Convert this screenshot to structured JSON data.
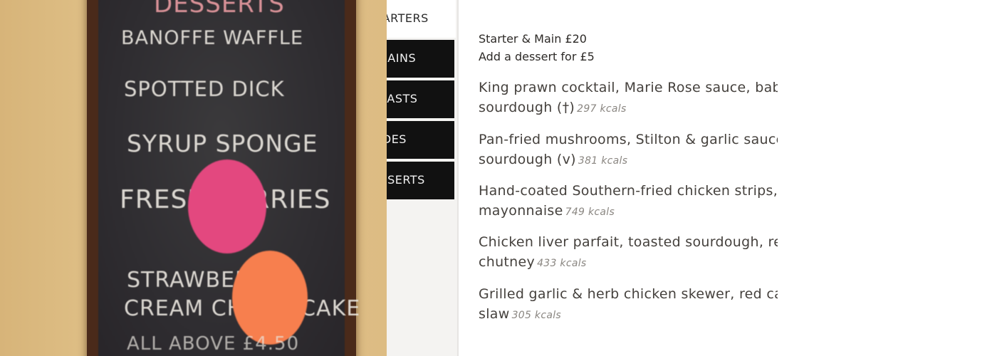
{
  "photo": {
    "board_heading": "Desserts",
    "board_lines": [
      "Banoffe Waffle",
      "Spotted Dick",
      "Syrup Sponge",
      "Fresh Berries",
      "Strawberry",
      "Cream Cheesecake",
      "All Above £4.50"
    ],
    "sticker_colors": [
      "#e3487f",
      "#f77f4e"
    ]
  },
  "nav": {
    "items": [
      {
        "label": "STARTERS",
        "state": "active"
      },
      {
        "label": "MAINS",
        "state": "dark"
      },
      {
        "label": "ROASTS",
        "state": "dark"
      },
      {
        "label": "SIDES",
        "state": "dark"
      },
      {
        "label": "DESSERTS",
        "state": "dark"
      }
    ]
  },
  "deal": {
    "line1": "Starter & Main £20",
    "line2": "Add a dessert for £5"
  },
  "dishes": [
    {
      "line1": "King prawn cocktail, Marie Rose sauce, baby gem, toasted",
      "line2": "sourdough (†)",
      "kcal": "297 kcals"
    },
    {
      "line1": "Pan-fried mushrooms, Stilton & garlic sauce, toasted",
      "line2": "sourdough (v)",
      "kcal": "381 kcals"
    },
    {
      "line1": "Hand-coated Southern-fried chicken strips, garlic",
      "line2": "mayonnaise",
      "kcal": "749 kcals"
    },
    {
      "line1": "Chicken liver parfait, toasted sourdough, red onion",
      "line2": "chutney",
      "kcal": "433 kcals"
    },
    {
      "line1": "Grilled garlic & herb chicken skewer, red cabbage",
      "line2": "slaw",
      "kcal": "305 kcals"
    }
  ],
  "colors": {
    "nav_dark": "#111111",
    "nav_bg": "#f4f3f1",
    "text": "#45413d",
    "kcal": "#8a8681"
  }
}
